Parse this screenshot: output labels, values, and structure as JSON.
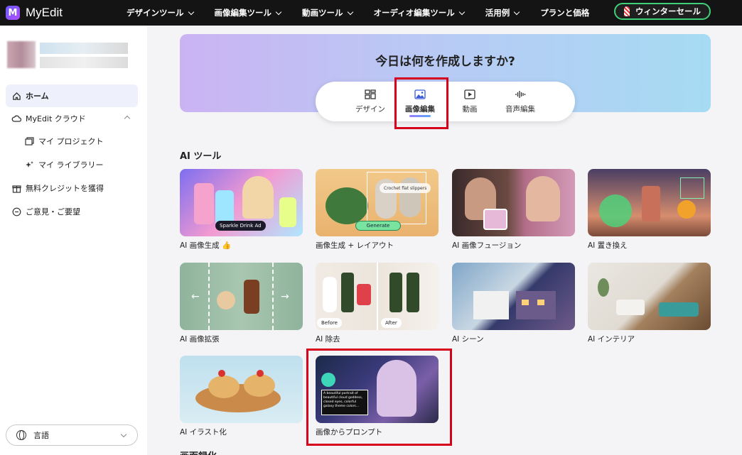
{
  "app": {
    "name": "MyEdit",
    "logo_letter": "M"
  },
  "nav": {
    "items": [
      {
        "label": "デザインツール",
        "has_dropdown": true
      },
      {
        "label": "画像編集ツール",
        "has_dropdown": true
      },
      {
        "label": "動画ツール",
        "has_dropdown": true
      },
      {
        "label": "オーディオ編集ツール",
        "has_dropdown": true
      },
      {
        "label": "活用例",
        "has_dropdown": true
      },
      {
        "label": "プランと価格",
        "has_dropdown": false
      }
    ],
    "sale_button": "ウィンターセール"
  },
  "sidebar": {
    "items": [
      {
        "label": "ホーム",
        "icon": "home-icon",
        "active": true
      },
      {
        "label": "MyEdit クラウド",
        "icon": "cloud-icon",
        "expanded": true
      },
      {
        "label": "マイ プロジェクト",
        "icon": "folder-icon"
      },
      {
        "label": "マイ ライブラリー",
        "icon": "sparkle-icon"
      },
      {
        "label": "無料クレジットを獲得",
        "icon": "gift-icon"
      },
      {
        "label": "ご意見・ご要望",
        "icon": "feedback-icon"
      }
    ],
    "language_button": "言語"
  },
  "hero": {
    "title": "今日は何を作成しますか?",
    "tabs": [
      {
        "label": "デザイン",
        "icon": "design-icon"
      },
      {
        "label": "画像編集",
        "icon": "image-icon",
        "active": true
      },
      {
        "label": "動画",
        "icon": "video-icon"
      },
      {
        "label": "音声編集",
        "icon": "audio-wave-icon"
      }
    ]
  },
  "ai_tools": {
    "section_title": "AI ツール",
    "cards": [
      {
        "label": "AI 画像生成 👍",
        "badge": "Sparkle Drink Ad"
      },
      {
        "label": "画像生成 + レイアウト",
        "badge": "Generate",
        "caption": "Crochet flat slippers"
      },
      {
        "label": "AI 画像フュージョン"
      },
      {
        "label": "AI 置き換え"
      },
      {
        "label": "AI 画像拡張"
      },
      {
        "label": "AI 除去",
        "before": "Before",
        "after": "After"
      },
      {
        "label": "AI シーン"
      },
      {
        "label": "AI インテリア"
      },
      {
        "label": "AI イラスト化"
      },
      {
        "label": "画像からプロンプト",
        "prompt_text": "A beautiful portrait of beautiful cloud goddess, closed eyes, colorful galaxy theme colors..."
      }
    ]
  },
  "next_section_title": "画面録化",
  "colors": {
    "highlight": "#d6001c",
    "accent": "#3fd07a",
    "topbar": "#141414"
  }
}
